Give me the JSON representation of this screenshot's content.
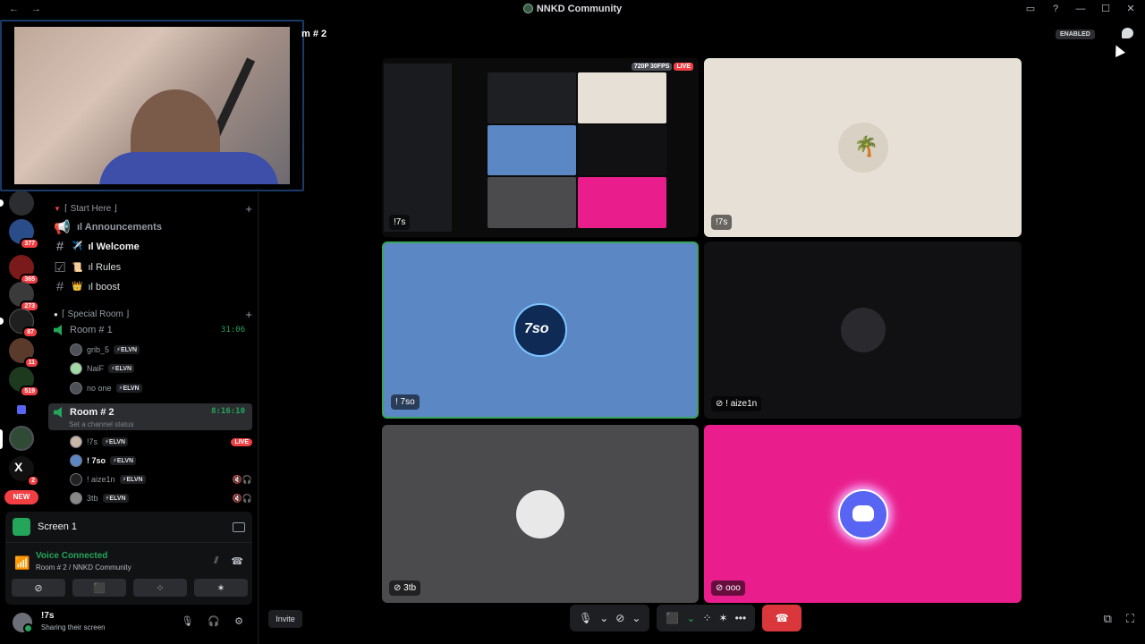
{
  "titlebar": {
    "title": "NNKD Community",
    "nav_back": "←",
    "nav_forward": "→",
    "icons": [
      "inbox-icon",
      "help-icon",
      "minimize-icon",
      "maximize-icon",
      "close-icon"
    ],
    "glyphs": {
      "inbox": "▭",
      "help": "?",
      "min": "—",
      "max": "☐",
      "close": "✕"
    }
  },
  "crumb": "m # 2",
  "enabled_badge": "ENABLED",
  "servers": [
    {
      "badge": ""
    },
    {
      "badge": "377"
    },
    {
      "badge": "365"
    },
    {
      "badge": "273"
    },
    {
      "badge": "87"
    },
    {
      "badge": "11"
    },
    {
      "badge": "519"
    },
    {
      "badge": ""
    },
    {
      "badge": ""
    },
    {
      "badge": "2"
    }
  ],
  "new_label": "NEW",
  "sidebar": {
    "cat1": {
      "label": "⌈ Start Here ⌋",
      "plus": "+"
    },
    "channels": [
      {
        "emoji": "",
        "label": "ıl Announcements",
        "hash": "📢"
      },
      {
        "emoji": "✈️",
        "label": "ıl Welcome",
        "hash": "#"
      },
      {
        "emoji": "📜",
        "label": "ıl Rules",
        "hash": "☑"
      },
      {
        "emoji": "👑",
        "label": "ıl boost",
        "hash": "#"
      }
    ],
    "cat2": {
      "label": "⌈ Special Room ⌋",
      "plus": "+"
    },
    "room1": {
      "label": "Room # 1",
      "time": "31:06"
    },
    "room1_members": [
      {
        "name": "grib_5",
        "tag": "⚡ELVN"
      },
      {
        "name": "NaiF",
        "tag": "⚡ELVN"
      },
      {
        "name": "no one",
        "tag": "⚡ELVN"
      }
    ],
    "room2": {
      "label": "Room # 2",
      "time": "8:16:10",
      "status": "Set a channel status"
    },
    "room2_members": [
      {
        "name": "!7s",
        "tag": "⚡ELVN",
        "extra": "LIVE"
      },
      {
        "name": "! 7so",
        "tag": "⚡ELVN",
        "extra": ""
      },
      {
        "name": "! aize1n",
        "tag": "⚡ELVN",
        "extra": "🔇🎧"
      },
      {
        "name": "3tb",
        "tag": "⚡ELVN",
        "extra": "🔇🎧"
      }
    ]
  },
  "screen_panel": {
    "label": "Screen 1"
  },
  "voice_panel": {
    "title": "Voice Connected",
    "subtitle": "Room # 2 / NNKD Community",
    "buttons": [
      "⊘",
      "⬛",
      "⁘",
      "✶"
    ]
  },
  "user": {
    "name": "!7s",
    "status": "Sharing their screen"
  },
  "invite": "Invite",
  "tiles": [
    {
      "label": "!7s",
      "res": "720P 30FPS",
      "live": "LIVE"
    },
    {
      "label": "!7s"
    },
    {
      "label": "! 7so"
    },
    {
      "label": "! aize1n"
    },
    {
      "label": "3tb"
    },
    {
      "label": "ooo"
    }
  ],
  "controls": {
    "mic": "🎙",
    "chev": "⌄",
    "camera": "⊘",
    "share": "⬛",
    "activities": "⁘",
    "soundboard": "✶",
    "more": "•••",
    "hangup": "☎",
    "popout": "⧉",
    "fullscreen": "⛶"
  },
  "colors": {
    "green": "#23a55a",
    "red": "#f23f43",
    "tile_blue": "#5b88c4",
    "tile_pink": "#e91e8c",
    "tile_sand": "#e7e0d6"
  }
}
